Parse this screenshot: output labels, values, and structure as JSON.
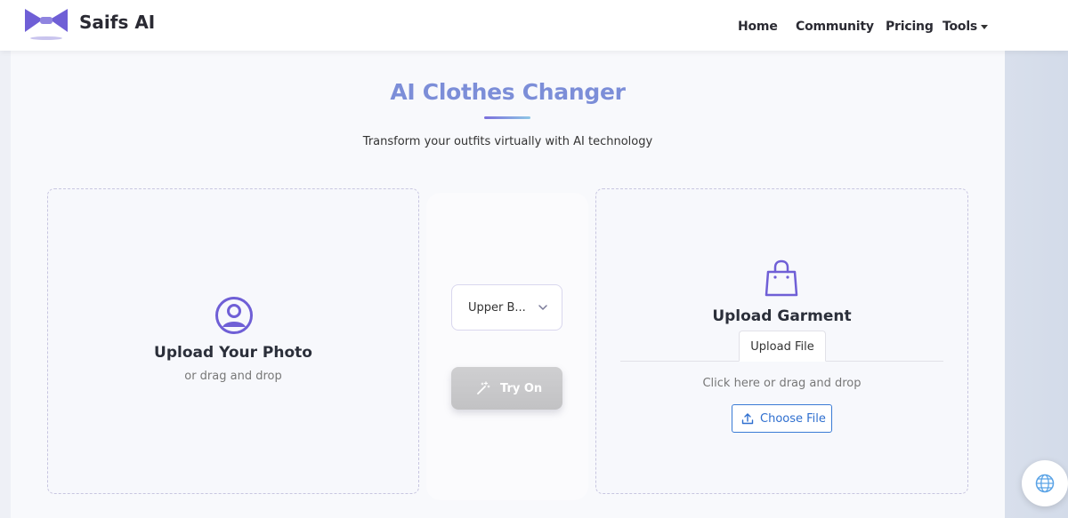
{
  "header": {
    "brand": "Saifs AI",
    "nav": {
      "home": "Home",
      "community": "Community",
      "pricing": "Pricing",
      "tools": "Tools"
    }
  },
  "main": {
    "title": "AI Clothes Changer",
    "subtitle": "Transform your outfits virtually with AI technology",
    "photo_upload": {
      "title": "Upload Your Photo",
      "hint": "or drag and drop"
    },
    "controls": {
      "garment_type_selected": "Upper B...",
      "try_on_label": "Try On"
    },
    "garment_upload": {
      "title": "Upload Garment",
      "tab_label": "Upload File",
      "hint": "Click here or drag and drop",
      "choose_file_label": "Choose File"
    }
  },
  "colors": {
    "accent": "#7c6fdc",
    "title": "#7c8ed8",
    "link_blue": "#2f6fcf",
    "disabled_button": "#c8c8ca"
  },
  "icons": {
    "logo": "saifs-logo-icon",
    "photo": "user-circle-icon",
    "select": "chevron-down-icon",
    "try_on": "magic-wand-icon",
    "garment": "shopping-bag-icon",
    "choose_file": "upload-icon",
    "language": "globe-icon"
  }
}
